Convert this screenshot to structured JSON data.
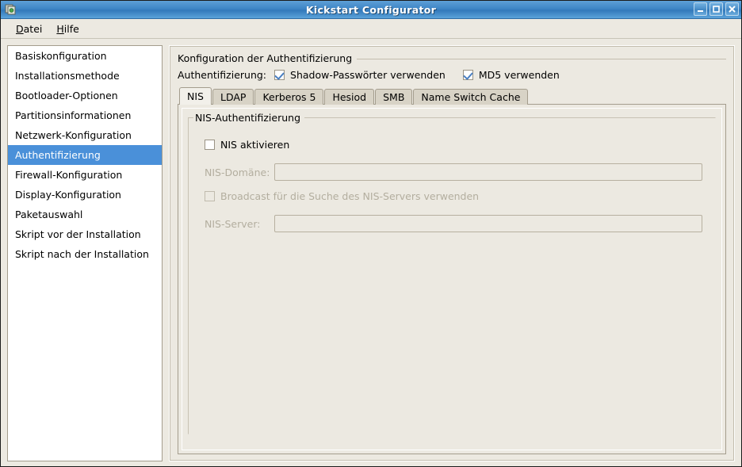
{
  "window": {
    "title": "Kickstart Configurator",
    "icon": "application-icon",
    "buttons": {
      "minimize": "minimize-icon",
      "maximize": "maximize-icon",
      "close": "close-icon"
    }
  },
  "menubar": {
    "items": [
      {
        "label": "Datei",
        "mnemonic": "D"
      },
      {
        "label": "Hilfe",
        "mnemonic": "H"
      }
    ]
  },
  "sidebar": {
    "items": [
      {
        "label": "Basiskonfiguration",
        "selected": false
      },
      {
        "label": "Installationsmethode",
        "selected": false
      },
      {
        "label": "Bootloader-Optionen",
        "selected": false
      },
      {
        "label": "Partitionsinformationen",
        "selected": false
      },
      {
        "label": "Netzwerk-Konfiguration",
        "selected": false
      },
      {
        "label": "Authentifizierung",
        "selected": true
      },
      {
        "label": "Firewall-Konfiguration",
        "selected": false
      },
      {
        "label": "Display-Konfiguration",
        "selected": false
      },
      {
        "label": "Paketauswahl",
        "selected": false
      },
      {
        "label": "Skript vor der Installation",
        "selected": false
      },
      {
        "label": "Skript nach der Installation",
        "selected": false
      }
    ]
  },
  "main": {
    "group_title": "Konfiguration der Authentifizierung",
    "auth_label": "Authentifizierung:",
    "options": [
      {
        "label": "Shadow-Passwörter verwenden",
        "checked": true
      },
      {
        "label": "MD5 verwenden",
        "checked": true
      }
    ],
    "tabs": [
      {
        "label": "NIS",
        "active": true
      },
      {
        "label": "LDAP",
        "active": false
      },
      {
        "label": "Kerberos 5",
        "active": false
      },
      {
        "label": "Hesiod",
        "active": false
      },
      {
        "label": "SMB",
        "active": false
      },
      {
        "label": "Name Switch Cache",
        "active": false
      }
    ],
    "nis": {
      "group_title": "NIS-Authentifizierung",
      "enable_label": "NIS aktivieren",
      "enable_checked": false,
      "domain_label": "NIS-Domäne:",
      "domain_value": "",
      "domain_disabled": true,
      "broadcast_label": "Broadcast für die Suche des NIS-Servers verwenden",
      "broadcast_checked": false,
      "broadcast_disabled": true,
      "server_label": "NIS-Server:",
      "server_value": "",
      "server_disabled": true
    }
  },
  "colors": {
    "titlebar_blue": "#3f86c6",
    "selection_blue": "#4a90d9",
    "check_blue": "#4a7fc1",
    "window_bg": "#ece9e1",
    "border": "#a49d8d",
    "disabled_text": "#b3ae9f"
  }
}
